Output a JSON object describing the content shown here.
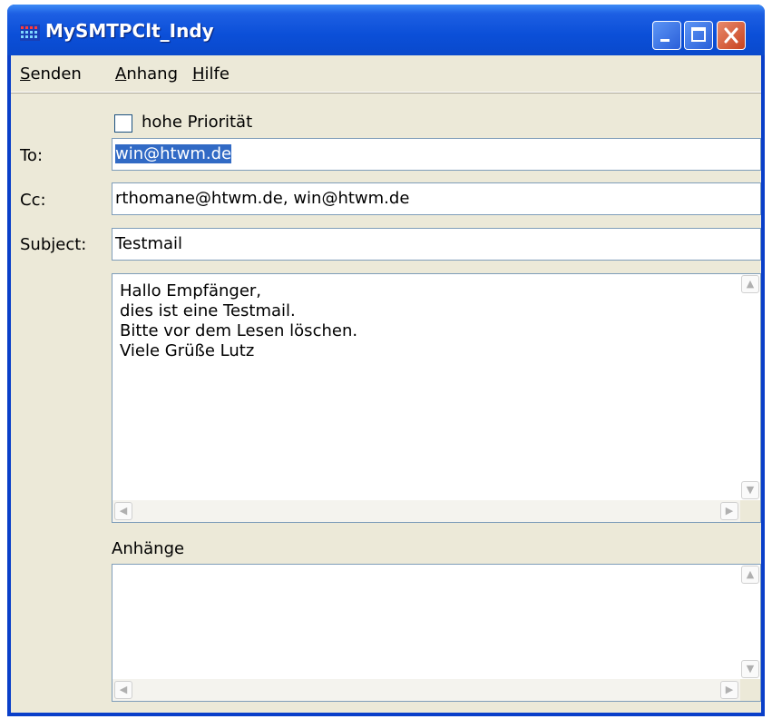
{
  "window": {
    "title": "MySMTPClt_Indy"
  },
  "menu": [
    {
      "label": "Senden",
      "accel": "S",
      "rest": "enden"
    },
    {
      "label": "Anhang",
      "accel": "A",
      "rest": "nhang"
    },
    {
      "label": "Hilfe",
      "accel": "H",
      "rest": "ilfe"
    }
  ],
  "priority": {
    "label": "hohe Priorität",
    "checked": false
  },
  "fields": {
    "to_label": "To:",
    "to_value": "win@htwm.de",
    "cc_label": "Cc:",
    "cc_value": "rthomane@htwm.de, win@htwm.de",
    "subject_label": "Subject:",
    "subject_value": "Testmail"
  },
  "body_text": "Hallo Empfänger,\ndies ist eine Testmail.\nBitte vor dem Lesen löschen.\nViele Grüße Lutz",
  "attachments": {
    "label": "Anhänge",
    "items": []
  },
  "icons": {
    "app": "app-grid-icon",
    "minimize": "minimize-icon",
    "maximize": "maximize-icon",
    "close": "close-icon",
    "scroll_up": "scroll-up-arrow-icon",
    "scroll_down": "scroll-down-arrow-icon",
    "scroll_left": "scroll-left-arrow-icon",
    "scroll_right": "scroll-right-arrow-icon"
  },
  "colors": {
    "titlebar": "#0b4fd8",
    "face": "#ece9d8",
    "selection": "#316ac5",
    "close": "#c8431f"
  }
}
